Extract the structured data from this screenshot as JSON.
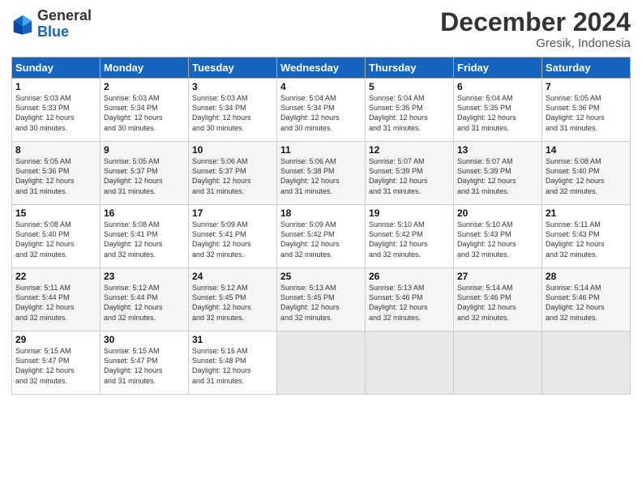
{
  "header": {
    "logo_general": "General",
    "logo_blue": "Blue",
    "month_title": "December 2024",
    "location": "Gresik, Indonesia"
  },
  "weekdays": [
    "Sunday",
    "Monday",
    "Tuesday",
    "Wednesday",
    "Thursday",
    "Friday",
    "Saturday"
  ],
  "weeks": [
    [
      {
        "day": "1",
        "info": "Sunrise: 5:03 AM\nSunset: 5:33 PM\nDaylight: 12 hours\nand 30 minutes."
      },
      {
        "day": "2",
        "info": "Sunrise: 5:03 AM\nSunset: 5:34 PM\nDaylight: 12 hours\nand 30 minutes."
      },
      {
        "day": "3",
        "info": "Sunrise: 5:03 AM\nSunset: 5:34 PM\nDaylight: 12 hours\nand 30 minutes."
      },
      {
        "day": "4",
        "info": "Sunrise: 5:04 AM\nSunset: 5:34 PM\nDaylight: 12 hours\nand 30 minutes."
      },
      {
        "day": "5",
        "info": "Sunrise: 5:04 AM\nSunset: 5:35 PM\nDaylight: 12 hours\nand 31 minutes."
      },
      {
        "day": "6",
        "info": "Sunrise: 5:04 AM\nSunset: 5:35 PM\nDaylight: 12 hours\nand 31 minutes."
      },
      {
        "day": "7",
        "info": "Sunrise: 5:05 AM\nSunset: 5:36 PM\nDaylight: 12 hours\nand 31 minutes."
      }
    ],
    [
      {
        "day": "8",
        "info": "Sunrise: 5:05 AM\nSunset: 5:36 PM\nDaylight: 12 hours\nand 31 minutes."
      },
      {
        "day": "9",
        "info": "Sunrise: 5:05 AM\nSunset: 5:37 PM\nDaylight: 12 hours\nand 31 minutes."
      },
      {
        "day": "10",
        "info": "Sunrise: 5:06 AM\nSunset: 5:37 PM\nDaylight: 12 hours\nand 31 minutes."
      },
      {
        "day": "11",
        "info": "Sunrise: 5:06 AM\nSunset: 5:38 PM\nDaylight: 12 hours\nand 31 minutes."
      },
      {
        "day": "12",
        "info": "Sunrise: 5:07 AM\nSunset: 5:39 PM\nDaylight: 12 hours\nand 31 minutes."
      },
      {
        "day": "13",
        "info": "Sunrise: 5:07 AM\nSunset: 5:39 PM\nDaylight: 12 hours\nand 31 minutes."
      },
      {
        "day": "14",
        "info": "Sunrise: 5:08 AM\nSunset: 5:40 PM\nDaylight: 12 hours\nand 32 minutes."
      }
    ],
    [
      {
        "day": "15",
        "info": "Sunrise: 5:08 AM\nSunset: 5:40 PM\nDaylight: 12 hours\nand 32 minutes."
      },
      {
        "day": "16",
        "info": "Sunrise: 5:08 AM\nSunset: 5:41 PM\nDaylight: 12 hours\nand 32 minutes."
      },
      {
        "day": "17",
        "info": "Sunrise: 5:09 AM\nSunset: 5:41 PM\nDaylight: 12 hours\nand 32 minutes."
      },
      {
        "day": "18",
        "info": "Sunrise: 5:09 AM\nSunset: 5:42 PM\nDaylight: 12 hours\nand 32 minutes."
      },
      {
        "day": "19",
        "info": "Sunrise: 5:10 AM\nSunset: 5:42 PM\nDaylight: 12 hours\nand 32 minutes."
      },
      {
        "day": "20",
        "info": "Sunrise: 5:10 AM\nSunset: 5:43 PM\nDaylight: 12 hours\nand 32 minutes."
      },
      {
        "day": "21",
        "info": "Sunrise: 5:11 AM\nSunset: 5:43 PM\nDaylight: 12 hours\nand 32 minutes."
      }
    ],
    [
      {
        "day": "22",
        "info": "Sunrise: 5:11 AM\nSunset: 5:44 PM\nDaylight: 12 hours\nand 32 minutes."
      },
      {
        "day": "23",
        "info": "Sunrise: 5:12 AM\nSunset: 5:44 PM\nDaylight: 12 hours\nand 32 minutes."
      },
      {
        "day": "24",
        "info": "Sunrise: 5:12 AM\nSunset: 5:45 PM\nDaylight: 12 hours\nand 32 minutes."
      },
      {
        "day": "25",
        "info": "Sunrise: 5:13 AM\nSunset: 5:45 PM\nDaylight: 12 hours\nand 32 minutes."
      },
      {
        "day": "26",
        "info": "Sunrise: 5:13 AM\nSunset: 5:46 PM\nDaylight: 12 hours\nand 32 minutes."
      },
      {
        "day": "27",
        "info": "Sunrise: 5:14 AM\nSunset: 5:46 PM\nDaylight: 12 hours\nand 32 minutes."
      },
      {
        "day": "28",
        "info": "Sunrise: 5:14 AM\nSunset: 5:46 PM\nDaylight: 12 hours\nand 32 minutes."
      }
    ],
    [
      {
        "day": "29",
        "info": "Sunrise: 5:15 AM\nSunset: 5:47 PM\nDaylight: 12 hours\nand 32 minutes."
      },
      {
        "day": "30",
        "info": "Sunrise: 5:15 AM\nSunset: 5:47 PM\nDaylight: 12 hours\nand 31 minutes."
      },
      {
        "day": "31",
        "info": "Sunrise: 5:16 AM\nSunset: 5:48 PM\nDaylight: 12 hours\nand 31 minutes."
      },
      {
        "day": "",
        "info": ""
      },
      {
        "day": "",
        "info": ""
      },
      {
        "day": "",
        "info": ""
      },
      {
        "day": "",
        "info": ""
      }
    ]
  ]
}
